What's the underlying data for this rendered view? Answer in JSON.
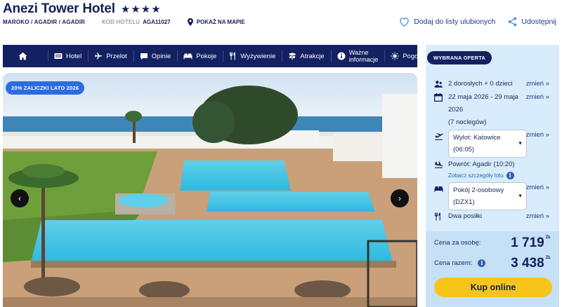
{
  "header": {
    "hotel_name": "Anezi Tower Hotel",
    "stars": "★★★★",
    "breadcrumb": "MAROKO / AGADIR / AGADIR",
    "code_label": "KOD HOTELU",
    "code_value": "AGA11027",
    "map_label": "POKAŻ NA MAPIE",
    "favorite_label": "Dodaj do listy ulubionych",
    "share_label": "Udostępnij"
  },
  "nav": {
    "items": [
      {
        "label": "",
        "icon": "home-icon"
      },
      {
        "label": "Hotel",
        "icon": "hotel-icon"
      },
      {
        "label": "Przelot",
        "icon": "plane-icon"
      },
      {
        "label": "Opinie",
        "icon": "chat-icon"
      },
      {
        "label": "Pokoje",
        "icon": "bed-icon"
      },
      {
        "label": "Wyżywienie",
        "icon": "cutlery-icon"
      },
      {
        "label": "Atrakcje",
        "icon": "signpost-icon"
      },
      {
        "label": "Ważne informacje",
        "line1": "Ważne",
        "line2": "informacje",
        "icon": "info-icon"
      },
      {
        "label": "Pogoda",
        "icon": "sun-icon"
      }
    ]
  },
  "gallery": {
    "promo_badge": "20% ZALICZKI LATO 2026",
    "prev": "‹",
    "next": "›"
  },
  "offer": {
    "badge": "WYBRANA OFERTA",
    "travelers": "2 dorosłych + 0 dzieci",
    "dates": "22 maja 2026 - 29 maja",
    "dates_line2": "2026",
    "nights": "(7 noclegów)",
    "departure_line1": "Wylot: Katowice",
    "departure_line2": "(06:05)",
    "return": "Powrót: Agadir (10:20)",
    "flight_details": "Zobacz szczegóły lotu",
    "room_line1": "Pokój 2-osobowy",
    "room_line2": "(DZX1)",
    "board": "Dwa posiłki",
    "change_label": "zmień"
  },
  "price": {
    "per_person_label": "Cena za osobę:",
    "per_person_value": "1 719",
    "total_label": "Cena razem:",
    "total_value": "3 438",
    "currency": "ZŁ",
    "buy_label": "Kup online"
  },
  "colors": {
    "navy": "#132061",
    "sidebar_bg": "#d8ecfb",
    "buy_button": "#f7c51a",
    "promo_blue": "#2d6cdf"
  }
}
